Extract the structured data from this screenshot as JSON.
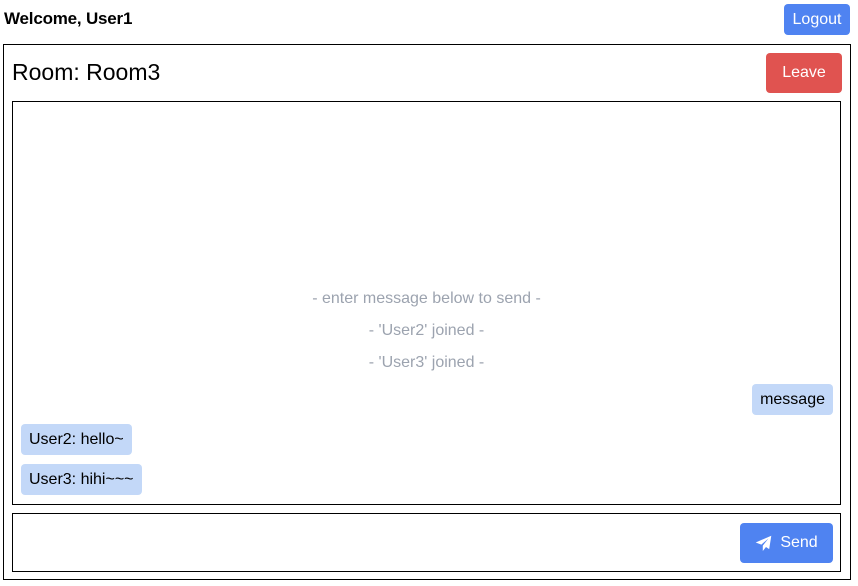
{
  "header": {
    "welcome": "Welcome, User1",
    "logout_label": "Logout"
  },
  "room": {
    "title": "Room: Room3",
    "leave_label": "Leave"
  },
  "messages": {
    "system": [
      "- enter message below to send -",
      "- 'User2' joined -",
      "- 'User3' joined -"
    ],
    "mine": [
      "message"
    ],
    "others": [
      "User2: hello~",
      "User3: hihi~~~"
    ]
  },
  "composer": {
    "value": "",
    "placeholder": "",
    "send_label": "Send",
    "send_icon": "paper-plane-icon"
  },
  "colors": {
    "primary": "#4f83f1",
    "danger": "#e05350",
    "bubble": "#c3d8f8",
    "system_text": "#9ca3af"
  }
}
